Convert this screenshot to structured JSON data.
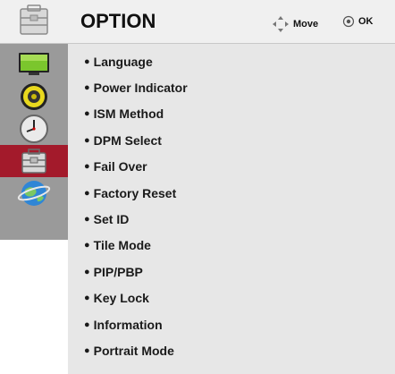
{
  "header": {
    "title": "OPTION",
    "move_label": "Move",
    "ok_label": "OK",
    "move_icon": "four-way-arrow-icon",
    "ok_icon": "ok-circle-icon"
  },
  "sidebar": {
    "header_icon": "toolbox-icon",
    "items": [
      {
        "icon": "picture-monitor-icon",
        "active": false
      },
      {
        "icon": "speaker-audio-icon",
        "active": false
      },
      {
        "icon": "clock-time-icon",
        "active": false
      },
      {
        "icon": "toolbox-option-icon",
        "active": true
      },
      {
        "icon": "network-globe-icon",
        "active": false
      }
    ]
  },
  "menu": {
    "bullet": "●",
    "items": [
      "Language",
      "Power Indicator",
      "ISM Method",
      "DPM Select",
      "Fail Over",
      "Factory Reset",
      "Set ID",
      "Tile Mode",
      "PIP/PBP",
      "Key Lock",
      "Information",
      "Portrait Mode"
    ]
  },
  "colors": {
    "active_tab": "#a31a2b",
    "sidebar_bg": "#9a9a9a",
    "panel_bg": "#e7e7e7",
    "header_bg": "#f0f0f0"
  }
}
